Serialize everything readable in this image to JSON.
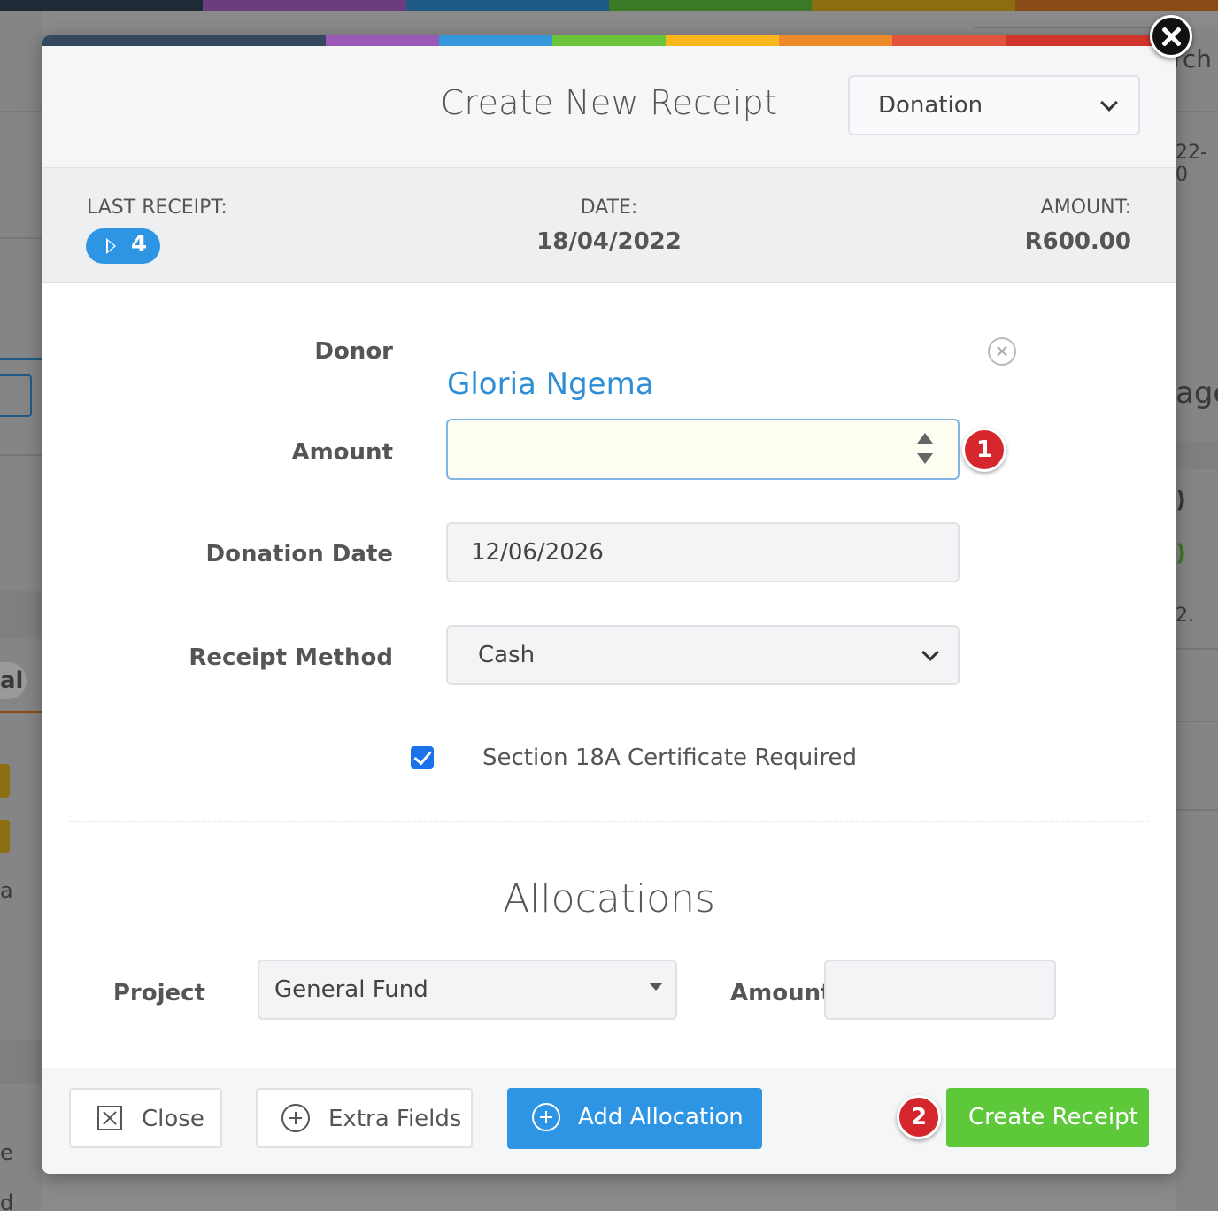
{
  "background": {
    "fragments": [
      "rch",
      "22-0",
      "age",
      ")",
      ")",
      "2.",
      "al",
      "a",
      "e",
      "d"
    ]
  },
  "modal": {
    "title": "Create New Receipt",
    "type_select": {
      "value": "Donation"
    },
    "stripe_colors": [
      "#34495e",
      "#9b59b6",
      "#3498db",
      "#6ac53b",
      "#f7b71d",
      "#ef8a2a",
      "#e2543e",
      "#d0352c"
    ]
  },
  "summary": {
    "last_receipt_label": "LAST RECEIPT:",
    "last_receipt_number": "4",
    "date_label": "DATE:",
    "date_value": "18/04/2022",
    "amount_label": "AMOUNT:",
    "amount_value": "R600.00"
  },
  "form": {
    "donor_label": "Donor",
    "donor_name": "Gloria Ngema",
    "amount_label": "Amount",
    "amount_value": "",
    "date_label": "Donation Date",
    "date_value": "12/06/2026",
    "method_label": "Receipt Method",
    "method_value": "Cash",
    "certificate_label": "Section 18A Certificate Required",
    "certificate_checked": true
  },
  "allocations": {
    "title": "Allocations",
    "project_label": "Project",
    "project_value": "General Fund",
    "amount_label": "Amount",
    "amount_value": ""
  },
  "footer": {
    "close_label": "Close",
    "extra_fields_label": "Extra Fields",
    "add_allocation_label": "Add Allocation",
    "create_receipt_label": "Create Receipt"
  },
  "annotations": {
    "step1": "1",
    "step2": "2"
  },
  "colors": {
    "accent_blue": "#2e95e4",
    "accent_green": "#5dc83a",
    "annotation_red": "#d6262d",
    "donor_link": "#2e8fd6"
  }
}
